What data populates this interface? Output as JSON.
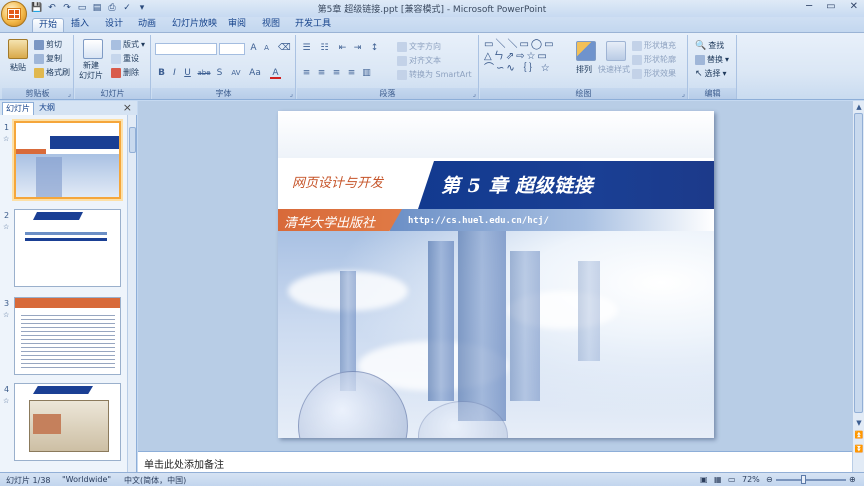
{
  "window": {
    "title": "第5章 超级链接.ppt [兼容模式] - Microsoft PowerPoint",
    "minimize": "─",
    "maximize": "▭",
    "close": "✕"
  },
  "quick_access": [
    "save",
    "undo",
    "redo",
    "new",
    "open",
    "print",
    "spelling",
    "more"
  ],
  "ribbon_tabs": [
    {
      "label": "开始",
      "active": true
    },
    {
      "label": "插入"
    },
    {
      "label": "设计"
    },
    {
      "label": "动画"
    },
    {
      "label": "幻灯片放映"
    },
    {
      "label": "审阅"
    },
    {
      "label": "视图"
    },
    {
      "label": "开发工具"
    }
  ],
  "groups": {
    "clipboard": {
      "label": "剪贴板",
      "paste": "粘贴",
      "cut": "剪切",
      "copy": "复制",
      "format_painter": "格式刷"
    },
    "slides": {
      "label": "幻灯片",
      "new_slide": "新建\n幻灯片",
      "layout": "版式",
      "reset": "重设",
      "delete": "删除"
    },
    "font": {
      "label": "字体",
      "font_value": "",
      "size_value": "",
      "bold": "B",
      "italic": "I",
      "underline": "U",
      "strike": "abe",
      "shadow": "S",
      "spacing": "AV",
      "case": "Aa",
      "color": "A"
    },
    "paragraph": {
      "label": "段落",
      "text_direction": "文字方向",
      "align_text": "对齐文本",
      "smartart": "转换为 SmartArt"
    },
    "drawing": {
      "label": "绘图",
      "arrange": "排列",
      "quick_styles": "快速样式",
      "shape_fill": "形状填充",
      "shape_outline": "形状轮廓",
      "shape_effects": "形状效果"
    },
    "editing": {
      "label": "编辑",
      "find": "查找",
      "replace": "替换",
      "select": "选择"
    }
  },
  "pane": {
    "tab_slides": "幻灯片",
    "tab_outline": "大纲",
    "close": "×",
    "thumbnails": [
      {
        "num": "1",
        "selected": true
      },
      {
        "num": "2"
      },
      {
        "num": "3"
      },
      {
        "num": "4"
      }
    ]
  },
  "slide": {
    "course": "网页设计与开发",
    "chapter": "第 5 章  超级链接",
    "publisher": "清华大学出版社",
    "url": "http://cs.huel.edu.cn/hcj/"
  },
  "notes": {
    "placeholder": "单击此处添加备注"
  },
  "status": {
    "slide_info": "幻灯片 1/38",
    "theme": "\"Worldwide\"",
    "language": "中文(简体，中国)",
    "zoom": "72%"
  }
}
